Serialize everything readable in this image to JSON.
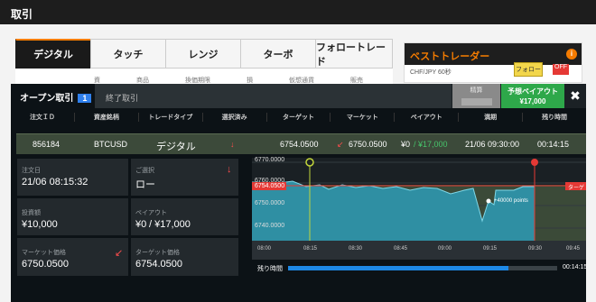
{
  "page_title": "取引",
  "tabs": [
    "デジタル",
    "タッチ",
    "レンジ",
    "ターボ",
    "フォロートレード"
  ],
  "subhead": [
    "資",
    "商品",
    "換価期限",
    "損",
    "仮想通貨",
    "販売"
  ],
  "best_trader": {
    "title": "ベストトレーダー",
    "row": "CHF/JPY 60秒",
    "follow_label": "フォロー",
    "bell_label": "OFF"
  },
  "overlay": {
    "open_tab": "オープン取引",
    "open_count": "1",
    "closed_tab": "終了取引",
    "sell_label": "精算",
    "payout_label": "予想ペイアウト",
    "payout_value": "¥17,000",
    "close_icon": "close-icon"
  },
  "columns": [
    "注文ＩＤ",
    "資産銘柄",
    "トレードタイプ",
    "選択済み",
    "ターゲット",
    "マーケット",
    "ペイアウト",
    "満期",
    "残り時間"
  ],
  "row": {
    "order_id": "856184",
    "asset": "BTCUSD",
    "type": "デジタル",
    "target": "6754.0500",
    "market": "6750.0500",
    "payout_now": "¥0",
    "payout_max": "/ ¥17,000",
    "expiry": "21/06 09:30:00",
    "remaining": "00:14:15"
  },
  "details": {
    "order_date_label": "注文日",
    "order_date": "21/06 08:15:32",
    "choice_label": "ご選択",
    "choice": "ロー",
    "investment_label": "投資額",
    "investment": "¥10,000",
    "payout_label": "ペイアウト",
    "payout_now": "¥0",
    "payout_max": "/ ¥17,000",
    "market_label": "マーケット価格",
    "market": "6750.0500",
    "target_label": "ターゲット価格",
    "target": "6754.0500"
  },
  "chart_labels": {
    "y": [
      "6770.0000",
      "6760.0000",
      "6754.0500",
      "6750.0000",
      "6740.0000"
    ],
    "x": [
      "08:00",
      "08:15",
      "08:30",
      "08:45",
      "09:00",
      "09:15",
      "09:30",
      "09:45"
    ],
    "point_label": "+40000 points",
    "target_tag": "ターゲ"
  },
  "progress": {
    "label": "残り時間",
    "fraction": 0.82,
    "time": "00:14:15"
  },
  "colors": {
    "green": "#2ea84a",
    "red": "#ff4d4d",
    "blue": "#1e88e5",
    "accent": "#f57c00"
  }
}
